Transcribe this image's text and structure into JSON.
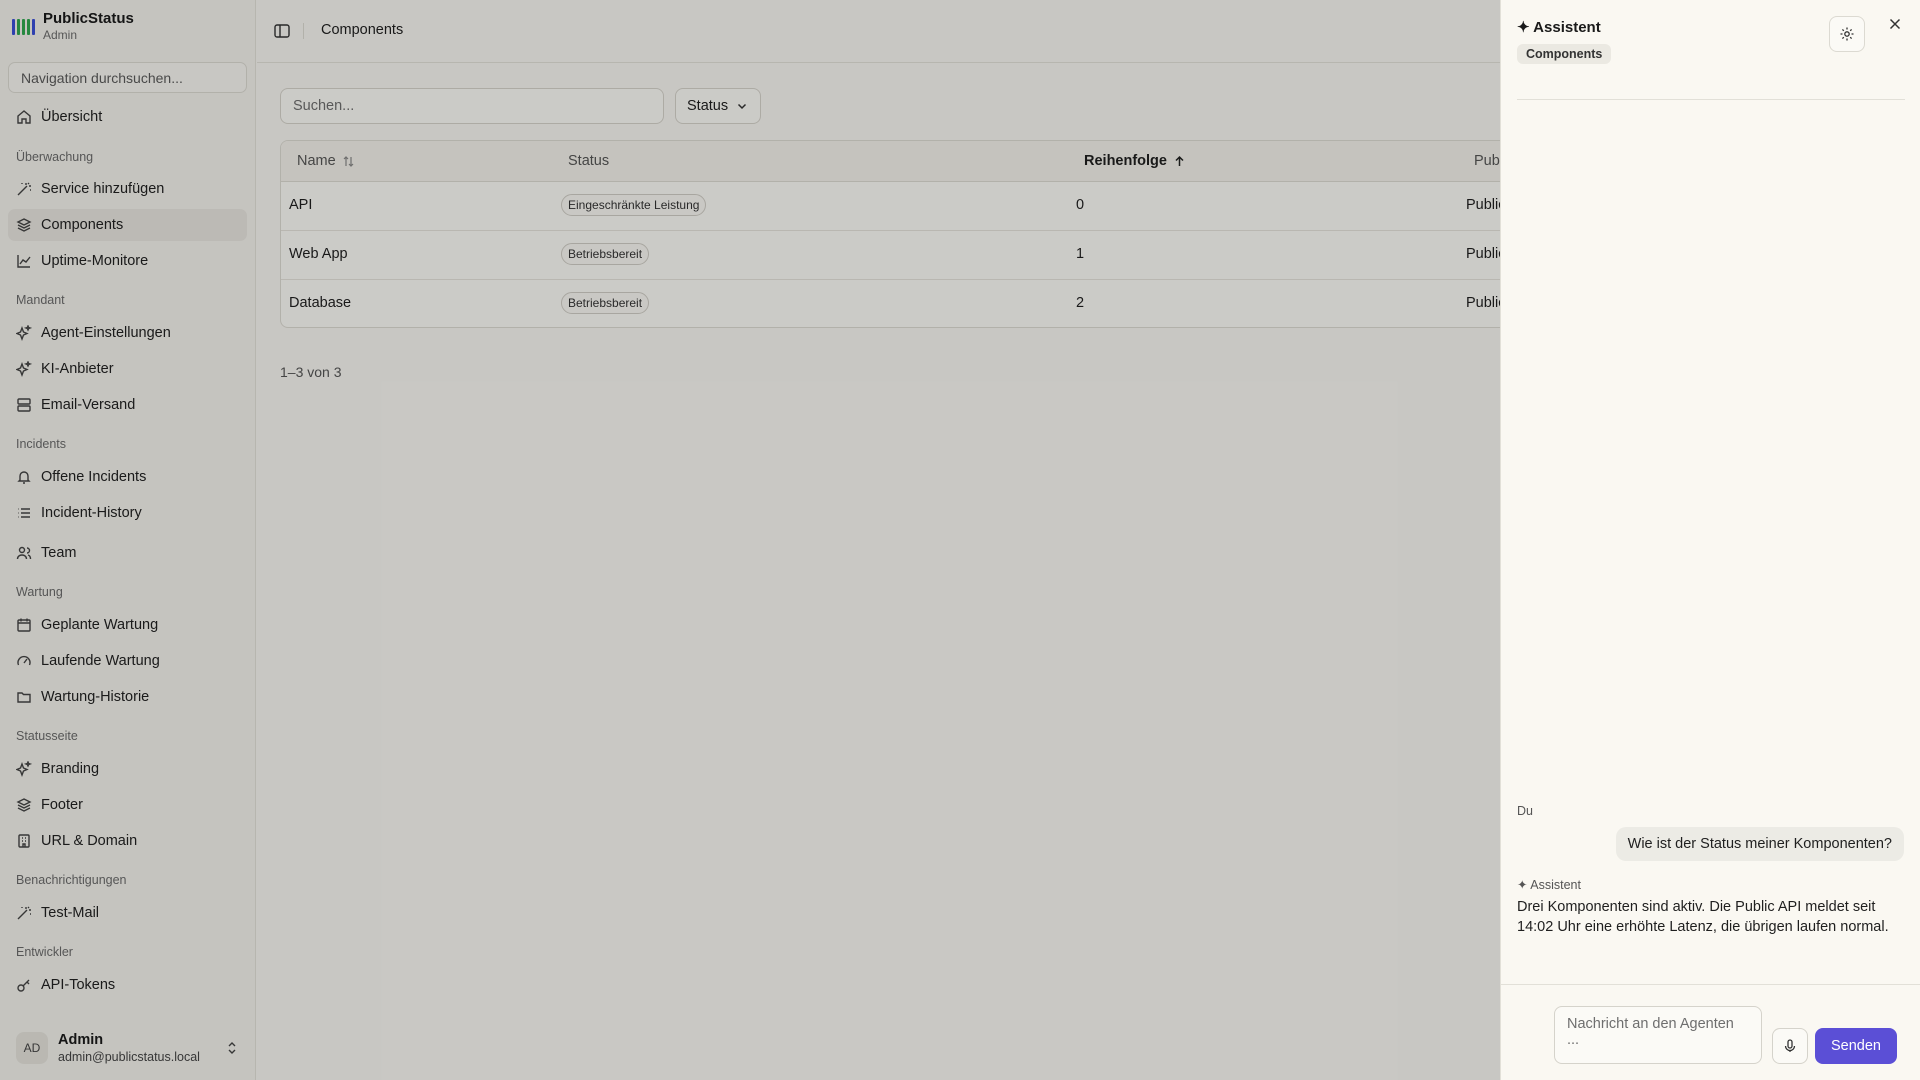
{
  "brand": {
    "name": "PublicStatus",
    "role": "Admin",
    "logo_colors": [
      "#3a4fd8",
      "#2fa84f",
      "#2fa84f",
      "#2fa84f",
      "#3a4fd8"
    ]
  },
  "sidebar": {
    "search_placeholder": "Navigation durchsuchen...",
    "sections": {
      "monitoring": "Überwachung",
      "tenant": "Mandant",
      "incidents": "Incidents",
      "maintenance": "Wartung",
      "statuspage": "Statusseite",
      "notifications": "Benachrichtigungen",
      "developer": "Entwickler"
    },
    "items": {
      "overview": "Übersicht",
      "add_service": "Service hinzufügen",
      "components": "Components",
      "uptime": "Uptime-Monitore",
      "agent_settings": "Agent-Einstellungen",
      "ai_provider": "KI-Anbieter",
      "email": "Email-Versand",
      "open_incidents": "Offene Incidents",
      "incident_history": "Incident-History",
      "team": "Team",
      "planned_maintenance": "Geplante Wartung",
      "running_maintenance": "Laufende Wartung",
      "maintenance_history": "Wartung-Historie",
      "branding": "Branding",
      "footer": "Footer",
      "url_domain": "URL & Domain",
      "test_mail": "Test-Mail",
      "api_tokens": "API-Tokens"
    },
    "user": {
      "initials": "AD",
      "name": "Admin",
      "email": "admin@publicstatus.local"
    }
  },
  "header": {
    "breadcrumb": "Components"
  },
  "toolbar": {
    "search_placeholder": "Suchen...",
    "status_filter": "Status"
  },
  "table": {
    "columns": {
      "name": "Name",
      "status": "Status",
      "order": "Reihenfolge",
      "public": "Pub"
    },
    "rows": [
      {
        "name": "API",
        "status": "Eingeschränkte Leistung",
        "order": "0",
        "public": "Public"
      },
      {
        "name": "Web App",
        "status": "Betriebsbereit",
        "order": "1",
        "public": "Public"
      },
      {
        "name": "Database",
        "status": "Betriebsbereit",
        "order": "2",
        "public": "Public"
      }
    ]
  },
  "pagination": "1–3 von 3",
  "assistant": {
    "title": "✦ Assistent",
    "context_chip": "Components",
    "user_label": "Du",
    "user_message": "Wie ist der Status meiner Komponenten?",
    "ai_label": "✦ Assistent",
    "ai_message": "Drei Komponenten sind aktiv. Die Public API meldet seit 14:02 Uhr eine erhöhte Latenz, die übrigen laufen normal.",
    "input_placeholder": "Nachricht an den Agenten ...",
    "send_label": "Senden",
    "accent": "#5b4fd6"
  }
}
